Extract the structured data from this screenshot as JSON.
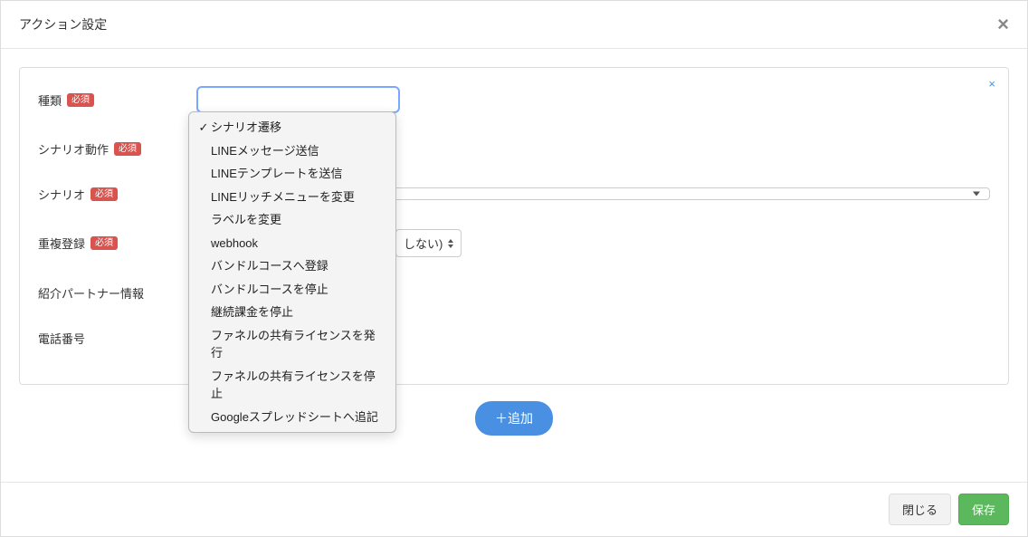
{
  "modal": {
    "title": "アクション設定",
    "close_icon": "×",
    "panel_close_icon": "×"
  },
  "form": {
    "required_badge": "必須",
    "labels": {
      "type": "種類",
      "scenario_action": "シナリオ動作",
      "scenario": "シナリオ",
      "duplicate": "重複登録",
      "partner_info": "紹介パートナー情報",
      "phone": "電話番号"
    },
    "values": {
      "duplicate_partial": "しない)",
      "scenario_selected": ""
    }
  },
  "dropdown": {
    "selected_index": 0,
    "check": "✓",
    "options": [
      "シナリオ遷移",
      "LINEメッセージ送信",
      "LINEテンプレートを送信",
      "LINEリッチメニューを変更",
      "ラベルを変更",
      "webhook",
      "バンドルコースへ登録",
      "バンドルコースを停止",
      "継続課金を停止",
      "ファネルの共有ライセンスを発行",
      "ファネルの共有ライセンスを停止",
      "Googleスプレッドシートへ追記"
    ]
  },
  "buttons": {
    "add": "＋追加",
    "close": "閉じる",
    "save": "保存"
  }
}
